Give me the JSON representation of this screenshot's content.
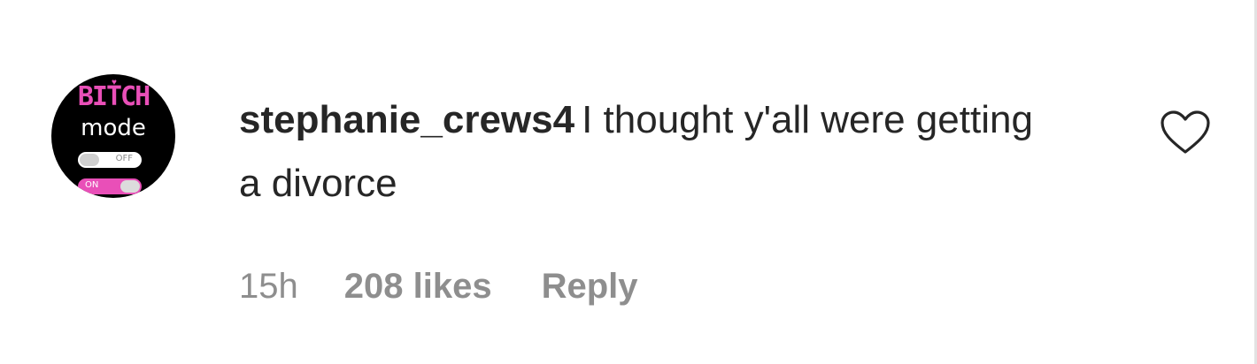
{
  "avatar": {
    "alt": "stephanie_crews4 profile picture",
    "line1": "BITCH",
    "line2": "mode",
    "toggle_off_label": "OFF",
    "toggle_on_label": "ON",
    "accent_color": "#e94fb8"
  },
  "comment": {
    "username": "stephanie_crews4",
    "text": "I thought y'all were getting a divorce"
  },
  "meta": {
    "time": "15h",
    "likes": "208 likes",
    "reply_label": "Reply"
  },
  "icons": {
    "like": "heart-outline-icon"
  },
  "colors": {
    "text": "#262626",
    "muted": "#8e8e8e",
    "background": "#ffffff"
  }
}
